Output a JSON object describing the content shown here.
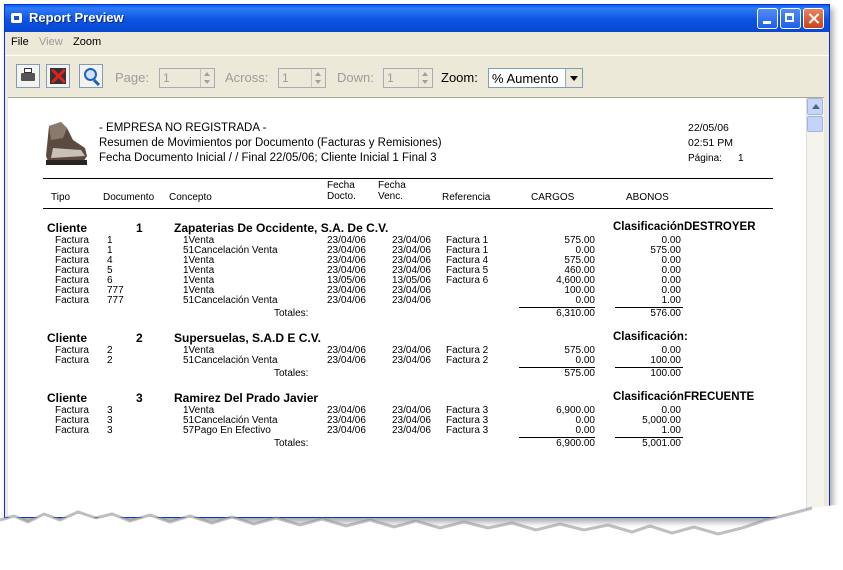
{
  "window": {
    "title": "Report Preview"
  },
  "menu": {
    "file": "File",
    "view": "View",
    "zoom": "Zoom"
  },
  "toolbar": {
    "page_label": "Page:",
    "page_value": "1",
    "across_label": "Across:",
    "across_value": "1",
    "down_label": "Down:",
    "down_value": "1",
    "zoom_label": "Zoom:",
    "zoom_value": "% Aumento"
  },
  "icons": {
    "print": "printer-icon",
    "cancel": "cancel-icon",
    "zoom": "magnifier-icon"
  },
  "report": {
    "company": "- EMPRESA NO REGISTRADA -",
    "title": "Resumen de Movimientos por Documento (Facturas y Remisiones)",
    "filter": "Fecha Documento Inicial   /  / Final 22/05/06;   Cliente Inicial 1 Final 3",
    "date": "22/05/06",
    "time": "02:51 PM",
    "page_label": "Página:",
    "page_number": "1",
    "columns": {
      "tipo": "Tipo",
      "documento": "Documento",
      "concepto": "Concepto",
      "fecha_docto_1": "Fecha",
      "fecha_docto_2": "Docto.",
      "fecha_venc_1": "Fecha",
      "fecha_venc_2": "Venc.",
      "referencia": "Referencia",
      "cargos": "CARGOS",
      "abonos": "ABONOS"
    },
    "totals_label": "Totales:",
    "clients": [
      {
        "label": "Cliente",
        "number": "1",
        "name": "Zapaterias De Occidente, S.A. De C.V.",
        "classification": "ClasificaciónDESTROYER",
        "rows": [
          [
            "Factura",
            "1",
            "1Venta",
            "23/04/06",
            "23/04/06",
            "Factura 1",
            "575.00",
            "0.00"
          ],
          [
            "Factura",
            "1",
            "51Cancelación Venta",
            "23/04/06",
            "23/04/06",
            "Factura 1",
            "0.00",
            "575.00"
          ],
          [
            "Factura",
            "4",
            "1Venta",
            "23/04/06",
            "23/04/06",
            "Factura 4",
            "575.00",
            "0.00"
          ],
          [
            "Factura",
            "5",
            "1Venta",
            "23/04/06",
            "23/04/06",
            "Factura 5",
            "460.00",
            "0.00"
          ],
          [
            "Factura",
            "6",
            "1Venta",
            "13/05/06",
            "13/05/06",
            "Factura 6",
            "4,600.00",
            "0.00"
          ],
          [
            "Factura",
            "777",
            "1Venta",
            "23/04/06",
            "23/04/06",
            "",
            "100.00",
            "0.00"
          ],
          [
            "Factura",
            "777",
            "51Cancelación Venta",
            "23/04/06",
            "23/04/06",
            "",
            "0.00",
            "1.00"
          ]
        ],
        "total_cargos": "6,310.00",
        "total_abonos": "576.00"
      },
      {
        "label": "Cliente",
        "number": "2",
        "name": "Supersuelas, S.A.D E C.V.",
        "classification": "Clasificación:",
        "rows": [
          [
            "Factura",
            "2",
            "1Venta",
            "23/04/06",
            "23/04/06",
            "Factura 2",
            "575.00",
            "0.00"
          ],
          [
            "Factura",
            "2",
            "51Cancelación Venta",
            "23/04/06",
            "23/04/06",
            "Factura 2",
            "0.00",
            "100.00"
          ]
        ],
        "total_cargos": "575.00",
        "total_abonos": "100.00"
      },
      {
        "label": "Cliente",
        "number": "3",
        "name": "Ramirez Del Prado Javier",
        "classification": "ClasificaciónFRECUENTE",
        "rows": [
          [
            "Factura",
            "3",
            "1Venta",
            "23/04/06",
            "23/04/06",
            "Factura 3",
            "6,900.00",
            "0.00"
          ],
          [
            "Factura",
            "3",
            "51Cancelación Venta",
            "23/04/06",
            "23/04/06",
            "Factura 3",
            "0.00",
            "5,000.00"
          ],
          [
            "Factura",
            "3",
            "57Pago En Efectivo",
            "23/04/06",
            "23/04/06",
            "Factura 3",
            "0.00",
            "1.00"
          ]
        ],
        "total_cargos": "6,900.00",
        "total_abonos": "5,001.00"
      }
    ]
  }
}
